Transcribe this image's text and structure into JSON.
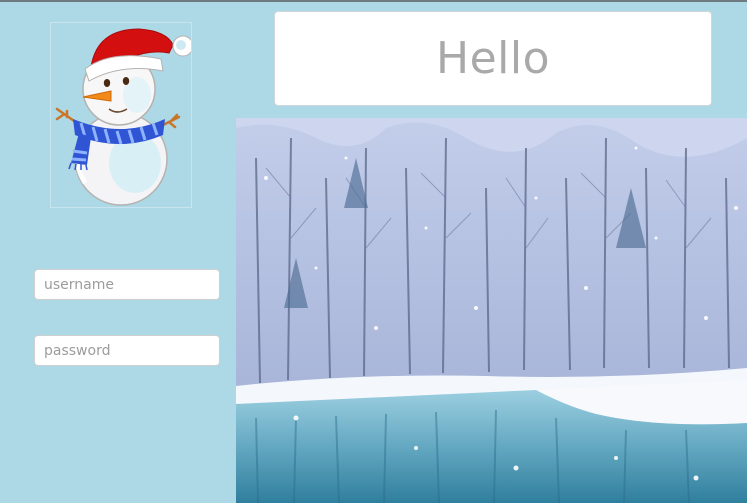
{
  "header": {
    "greeting": "Hello"
  },
  "login": {
    "username_placeholder": "username",
    "password_placeholder": "password"
  },
  "images": {
    "logo": "snowman-icon",
    "scene": "snowy-forest-lake-image"
  },
  "colors": {
    "page_background": "#add8e6",
    "greeting_text": "#a9a9a9",
    "hat_red": "#d40f0f",
    "scarf_blue": "#2f55d4"
  }
}
